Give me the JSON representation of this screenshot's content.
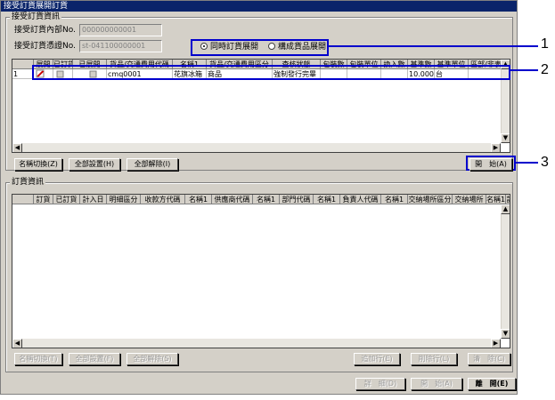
{
  "window": {
    "title": "接受訂貨展開訂貨"
  },
  "accept_group": {
    "label": "接受訂貨資訊",
    "fields": [
      {
        "label": "接受訂貨內部No.",
        "value": "000000000001"
      },
      {
        "label": "接受訂貨憑證No.",
        "value": "st-041100000001"
      }
    ]
  },
  "radios": [
    {
      "label": "同時訂貨展開",
      "selected": true
    },
    {
      "label": "構成貨品展開",
      "selected": false
    }
  ],
  "top_grid": {
    "headers": [
      "",
      "展開",
      "已訂貨",
      "已展開",
      "貨品/交通費用代碼",
      "名稱1",
      "貨品/交通費用區分",
      "査核狀態",
      "包裝數",
      "包裝單位",
      "換入數",
      "基準數",
      "基準單位",
      "區部/非表代"
    ],
    "rows": [
      {
        "num": "1",
        "code": "cmq0001",
        "name": "花旗冰箱",
        "kind": "商品",
        "status": "強制發行完畢",
        "qty": "10.0000",
        "unit": "台"
      }
    ]
  },
  "top_buttons": {
    "name_switch": "名稱切換(Z)",
    "select_all": "全部設置(H)",
    "clear_all": "全部解除(I)",
    "start": "開　始(A)"
  },
  "order_group": {
    "label": "訂貨資訊",
    "headers": [
      "",
      "訂貨",
      "已訂貨",
      "計入日",
      "明細區分",
      "收款方代碼",
      "名稱1",
      "供應商代碼",
      "名稱1",
      "部門代碼",
      "名稱1",
      "負責人代碼",
      "名稱1",
      "交納場所區分",
      "交納場所",
      "名稱1",
      "訂"
    ]
  },
  "bottom_buttons": {
    "name_switch": "名稱切換(T)",
    "select_all": "全部設置(F)",
    "clear_all": "全部解除(S)",
    "add_row": "追加行(E)",
    "delete_row": "削除行(L)",
    "clear": "清　除(C)"
  },
  "footer_buttons": {
    "detail": "詳　細(D)",
    "start": "開　始(A)",
    "close": "離　開(E)"
  },
  "callouts": [
    "1",
    "2",
    "3"
  ],
  "colors": {
    "callout": "#0000cc",
    "title_bar": "#0a246a",
    "checkbox_red": "#cc0000"
  }
}
